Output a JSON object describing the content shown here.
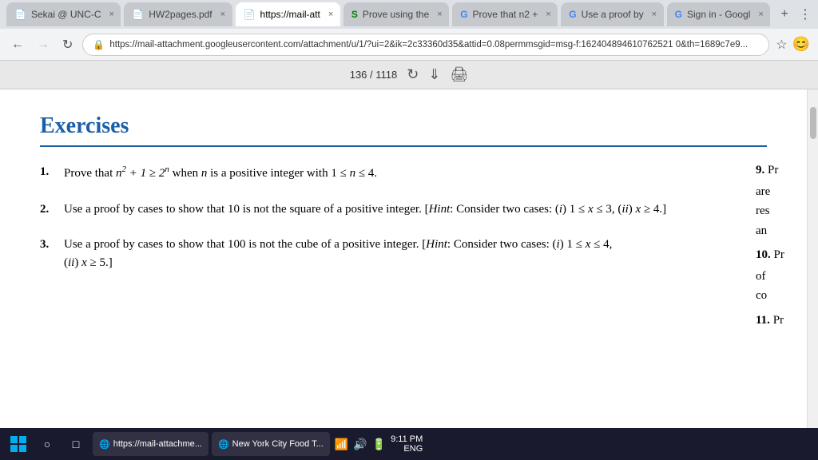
{
  "browser": {
    "tabs": [
      {
        "id": "tab1",
        "label": "Sekai @ UNC-C",
        "icon": "📄",
        "active": false
      },
      {
        "id": "tab2",
        "label": "HW2pages.pdf",
        "icon": "📄",
        "active": false
      },
      {
        "id": "tab3",
        "label": "https://mail-att",
        "icon": "📄",
        "active": true
      },
      {
        "id": "tab4",
        "label": "Prove using the",
        "icon": "S",
        "active": false
      },
      {
        "id": "tab5",
        "label": "Prove that n2 +",
        "icon": "G",
        "active": false
      },
      {
        "id": "tab6",
        "label": "Use a proof by",
        "icon": "G",
        "active": false
      },
      {
        "id": "tab7",
        "label": "Sign in - Googl",
        "icon": "G",
        "active": false
      }
    ],
    "url": "https://mail-attachment.googleusercontent.com/attachment/u/1/?ui=2&ik=2c33360d35&attid=0.08permmsgid=msg-f:162404894610762521 0&th=1689c7e9...",
    "back_disabled": false,
    "forward_disabled": false
  },
  "pdf": {
    "current_page": "136",
    "total_pages": "1118",
    "page_label": "136 / 1118"
  },
  "content": {
    "heading": "Exercises",
    "divider": true,
    "exercises": [
      {
        "number": "1.",
        "text": "Prove that n² + 1 ≥ 2ⁿ when n is a positive integer with 1 ≤ n ≤ 4."
      },
      {
        "number": "2.",
        "text": "Use a proof by cases to show that 10 is not the square of a positive integer. [Hint: Consider two cases: (i) 1 ≤ x ≤ 3, (ii) x ≥ 4.]"
      },
      {
        "number": "3.",
        "text": "Use a proof by cases to show that 100 is not the cube of a positive integer. [Hint: Consider two cases: (i) 1 ≤ x ≤ 4, (ii) x ≥ 5.]"
      }
    ],
    "right_column": {
      "item9_label": "9.",
      "item9_partial": "Pr",
      "item9_text1": "are",
      "item9_text2": "res",
      "item9_text3": "an",
      "item10_label": "10.",
      "item10_partial": "Pr",
      "item10_text1": "of",
      "item10_text2": "co",
      "item11_label": "11.",
      "item11_partial": "Pr"
    }
  },
  "taskbar": {
    "apps": [
      {
        "label": "https://mail-attachme...",
        "icon": "🌐"
      },
      {
        "label": "New York City Food T...",
        "icon": "🌐"
      }
    ],
    "sys_tray": {
      "language": "ENG",
      "time": "9:11 PM"
    }
  }
}
